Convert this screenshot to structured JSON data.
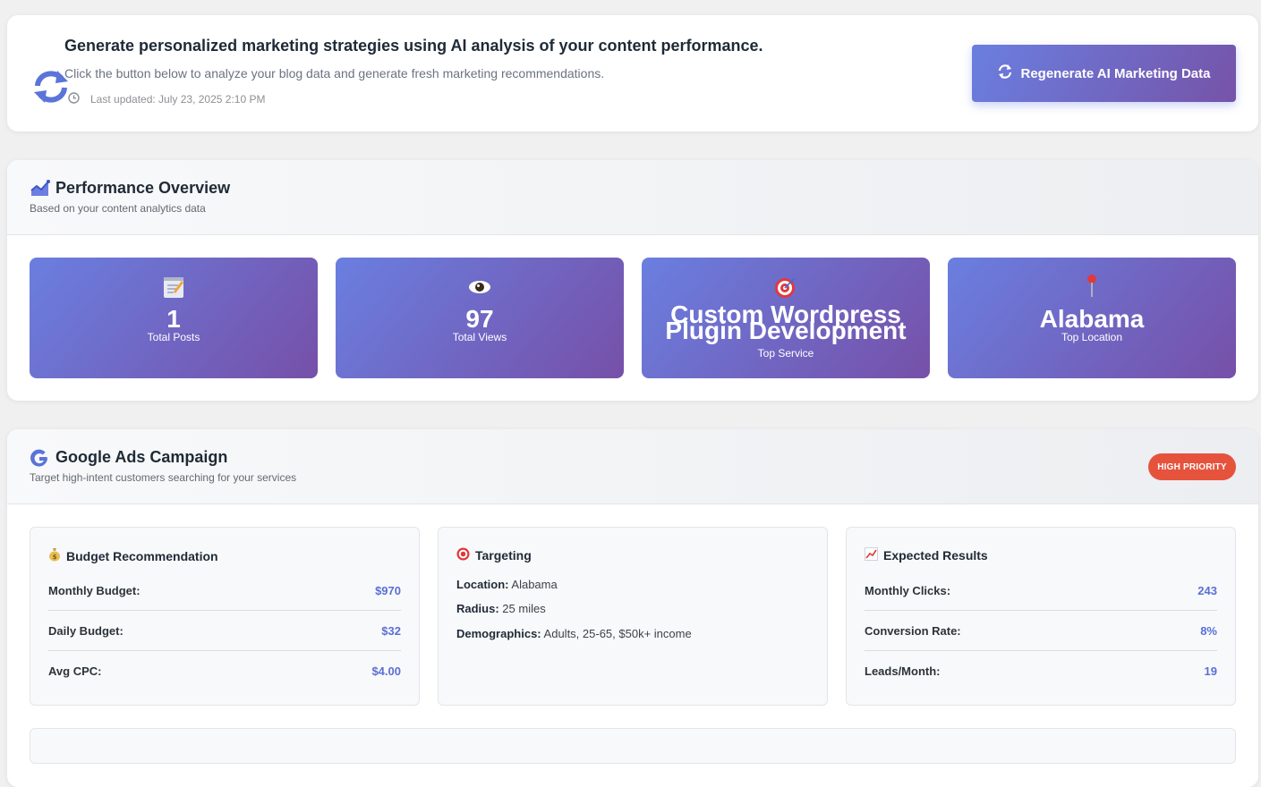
{
  "hero": {
    "title": "Generate personalized marketing strategies using AI analysis of your content performance.",
    "subtitle": "Click the button below to analyze your blog data and generate fresh marketing recommendations.",
    "last_updated": "Last updated: July 23, 2025 2:10 PM",
    "button_label": "Regenerate AI Marketing Data",
    "icon": "sync-icon",
    "accent_color": "#667eea"
  },
  "performance": {
    "title": "Performance Overview",
    "subtitle": "Based on your content analytics data",
    "icon": "chart-area-icon",
    "stats": [
      {
        "icon": "memo-icon",
        "value": "1",
        "label": "Total Posts"
      },
      {
        "icon": "eye-icon",
        "value": "97",
        "label": "Total Views"
      },
      {
        "icon": "target-icon",
        "value": "Custom Wordpress Plugin Development",
        "label": "Top Service"
      },
      {
        "icon": "pin-icon",
        "value": "Alabama",
        "label": "Top Location"
      }
    ]
  },
  "google_ads": {
    "title": "Google Ads Campaign",
    "subtitle": "Target high-intent customers searching for your services",
    "priority": "HIGH PRIORITY",
    "priority_color": "#e5533d",
    "budget": {
      "title": "Budget Recommendation",
      "rows": [
        {
          "label": "Monthly Budget:",
          "value": "$970"
        },
        {
          "label": "Daily Budget:",
          "value": "$32"
        },
        {
          "label": "Avg CPC:",
          "value": "$4.00"
        }
      ]
    },
    "targeting": {
      "title": "Targeting",
      "rows": [
        {
          "label": "Location:",
          "value": "Alabama"
        },
        {
          "label": "Radius:",
          "value": "25 miles"
        },
        {
          "label": "Demographics:",
          "value": "Adults, 25-65, $50k+ income"
        }
      ]
    },
    "results": {
      "title": "Expected Results",
      "rows": [
        {
          "label": "Monthly Clicks:",
          "value": "243"
        },
        {
          "label": "Conversion Rate:",
          "value": "8%"
        },
        {
          "label": "Leads/Month:",
          "value": "19"
        }
      ]
    }
  }
}
